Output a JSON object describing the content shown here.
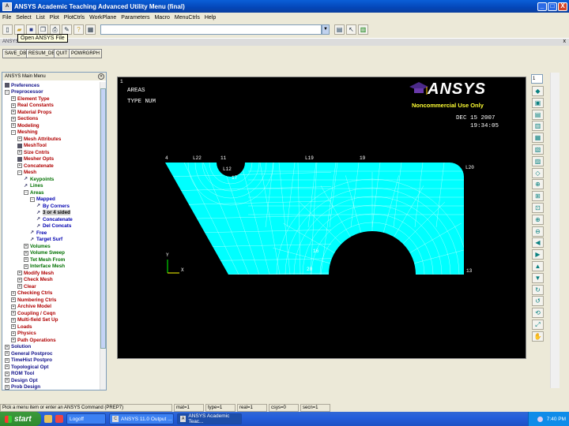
{
  "window": {
    "title": "ANSYS Academic Teaching Advanced Utility Menu (final)",
    "app_icon": "ansys-icon",
    "controls": {
      "minimize": "_",
      "maximize": "□",
      "close": "X"
    }
  },
  "menubar": [
    "File",
    "Select",
    "List",
    "Plot",
    "PlotCtrls",
    "WorkPlane",
    "Parameters",
    "Macro",
    "MenuCtrls",
    "Help"
  ],
  "toolbar": {
    "tooltip": "Open ANSYS File",
    "command_input": {
      "value": "",
      "placeholder": ""
    },
    "icons": [
      "new-file-icon",
      "open-folder-icon",
      "save-icon",
      "copy-icon",
      "print-icon",
      "report-icon",
      "help-icon",
      "image-icon"
    ],
    "right_icons": [
      "raise-hidden-icon",
      "reset-picking-icon",
      "contact-manager-icon"
    ]
  },
  "toolbar_panel": {
    "label": "ANSYS Toolbar",
    "close": "x",
    "buttons": [
      "SAVE_DB",
      "RESUM_DB",
      "QUIT",
      "POWRGRPH"
    ]
  },
  "main_menu": {
    "title": "ANSYS Main Menu",
    "collapse": "«",
    "tree": [
      {
        "label": "Preferences",
        "level": 0,
        "kind": "sq",
        "color": "blk"
      },
      {
        "label": "Preprocessor",
        "level": 0,
        "kind": "minus",
        "color": "blk"
      },
      {
        "label": "Element Type",
        "level": 1,
        "kind": "plus",
        "color": "red"
      },
      {
        "label": "Real Constants",
        "level": 1,
        "kind": "plus",
        "color": "red"
      },
      {
        "label": "Material Props",
        "level": 1,
        "kind": "plus",
        "color": "red"
      },
      {
        "label": "Sections",
        "level": 1,
        "kind": "plus",
        "color": "red"
      },
      {
        "label": "Modeling",
        "level": 1,
        "kind": "plus",
        "color": "red"
      },
      {
        "label": "Meshing",
        "level": 1,
        "kind": "minus",
        "color": "red"
      },
      {
        "label": "Mesh Attributes",
        "level": 2,
        "kind": "plus",
        "color": "red"
      },
      {
        "label": "MeshTool",
        "level": 2,
        "kind": "sq",
        "color": "red"
      },
      {
        "label": "Size Cntrls",
        "level": 2,
        "kind": "plus",
        "color": "red"
      },
      {
        "label": "Mesher Opts",
        "level": 2,
        "kind": "sq",
        "color": "red"
      },
      {
        "label": "Concatenate",
        "level": 2,
        "kind": "plus",
        "color": "red"
      },
      {
        "label": "Mesh",
        "level": 2,
        "kind": "minus",
        "color": "red"
      },
      {
        "label": "Keypoints",
        "level": 3,
        "kind": "leaf",
        "color": "grn"
      },
      {
        "label": "Lines",
        "level": 3,
        "kind": "leaf",
        "color": "grn"
      },
      {
        "label": "Areas",
        "level": 3,
        "kind": "minus",
        "color": "grn"
      },
      {
        "label": "Mapped",
        "level": 4,
        "kind": "minus",
        "color": "blu"
      },
      {
        "label": "By Corners",
        "level": 5,
        "kind": "leaf",
        "color": "blu"
      },
      {
        "label": "3 or 4 sided",
        "level": 5,
        "kind": "leaf",
        "color": "sel"
      },
      {
        "label": "Concatenate",
        "level": 5,
        "kind": "leaf",
        "color": "blu"
      },
      {
        "label": "Del Concats",
        "level": 5,
        "kind": "leaf",
        "color": "blu"
      },
      {
        "label": "Free",
        "level": 4,
        "kind": "leaf",
        "color": "blu"
      },
      {
        "label": "Target Surf",
        "level": 4,
        "kind": "leaf",
        "color": "blu"
      },
      {
        "label": "Volumes",
        "level": 3,
        "kind": "plus",
        "color": "grn"
      },
      {
        "label": "Volume Sweep",
        "level": 3,
        "kind": "plus",
        "color": "grn"
      },
      {
        "label": "Tet Mesh From",
        "level": 3,
        "kind": "plus",
        "color": "grn"
      },
      {
        "label": "Interface Mesh",
        "level": 3,
        "kind": "plus",
        "color": "grn"
      },
      {
        "label": "Modify Mesh",
        "level": 2,
        "kind": "plus",
        "color": "red"
      },
      {
        "label": "Check Mesh",
        "level": 2,
        "kind": "plus",
        "color": "red"
      },
      {
        "label": "Clear",
        "level": 2,
        "kind": "plus",
        "color": "red"
      },
      {
        "label": "Checking Ctrls",
        "level": 1,
        "kind": "plus",
        "color": "red"
      },
      {
        "label": "Numbering Ctrls",
        "level": 1,
        "kind": "plus",
        "color": "red"
      },
      {
        "label": "Archive Model",
        "level": 1,
        "kind": "plus",
        "color": "red"
      },
      {
        "label": "Coupling / Ceqn",
        "level": 1,
        "kind": "plus",
        "color": "red"
      },
      {
        "label": "Multi-field Set Up",
        "level": 1,
        "kind": "plus",
        "color": "red"
      },
      {
        "label": "Loads",
        "level": 1,
        "kind": "plus",
        "color": "red"
      },
      {
        "label": "Physics",
        "level": 1,
        "kind": "plus",
        "color": "red"
      },
      {
        "label": "Path Operations",
        "level": 1,
        "kind": "plus",
        "color": "red"
      },
      {
        "label": "Solution",
        "level": 0,
        "kind": "plus",
        "color": "blk"
      },
      {
        "label": "General Postproc",
        "level": 0,
        "kind": "plus",
        "color": "blk"
      },
      {
        "label": "TimeHist Postpro",
        "level": 0,
        "kind": "plus",
        "color": "blk"
      },
      {
        "label": "Topological Opt",
        "level": 0,
        "kind": "plus",
        "color": "blk"
      },
      {
        "label": "ROM Tool",
        "level": 0,
        "kind": "plus",
        "color": "blk"
      },
      {
        "label": "Design Opt",
        "level": 0,
        "kind": "plus",
        "color": "blk"
      },
      {
        "label": "Prob Design",
        "level": 0,
        "kind": "plus",
        "color": "blk"
      }
    ]
  },
  "graphics": {
    "window_number": "1",
    "plot_title": "AREAS",
    "plot_subtitle": "TYPE NUM",
    "logo": "ANSYS",
    "logo_sub": "Noncommercial Use Only",
    "date": "DEC 15 2007",
    "time": "19:34:05",
    "area_color": "#00ffff",
    "mesh_color": "#ffffff",
    "labels": [
      "4",
      "L22",
      "11",
      "L12",
      "17",
      "L19",
      "19",
      "L20",
      "16",
      "20",
      "13"
    ],
    "triad": {
      "x": "X",
      "y": "Y"
    }
  },
  "right_toolbar": {
    "window_select": "1",
    "icons": [
      "iso-view-icon",
      "front-view-icon",
      "top-view-icon",
      "right-view-icon",
      "back-view-icon",
      "bottom-view-icon",
      "left-view-icon",
      "oblique-view-icon",
      "zoom-icon",
      "box-zoom-icon",
      "win-zoom-icon",
      "zoom-in-icon",
      "zoom-out-icon",
      "pan-left-icon",
      "pan-right-icon",
      "pan-up-icon",
      "pan-down-icon",
      "rotate-x-icon",
      "rotate-y-icon",
      "rotate-z-icon",
      "fit-icon",
      "dynamic-mode-icon"
    ]
  },
  "statusbar": {
    "prompt": "Pick a menu item or enter an ANSYS Command (PREP7)",
    "mat": "mat=1",
    "type": "type=1",
    "real": "real=1",
    "csys": "csys=0",
    "secn": "secn=1"
  },
  "taskbar": {
    "start": "start",
    "tasks": [
      "Logoff",
      "ANSYS 11.0 Output ...",
      "ANSYS Academic Teac..."
    ],
    "clock": "7:40 PM"
  }
}
